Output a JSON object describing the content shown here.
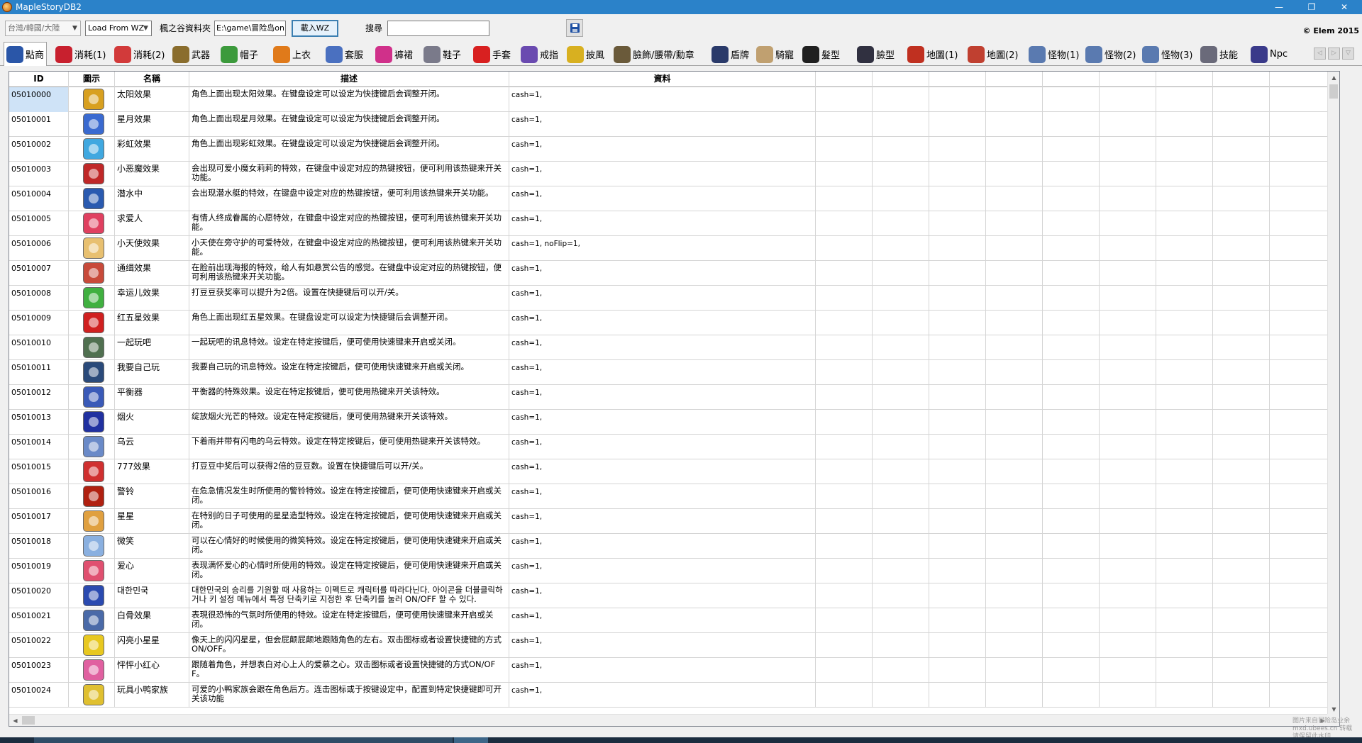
{
  "window": {
    "title": "MapleStoryDB2",
    "minimize": "—",
    "maximize": "❐",
    "close": "✕"
  },
  "toolbar": {
    "region_select": "台灣/韓國/大陸",
    "source_select": "Load From WZ",
    "folder_label": "楓之谷資料夾",
    "folder_path": "E:\\game\\冒险岛onl",
    "load_button": "載入WZ",
    "search_label": "搜尋",
    "search_value": "",
    "copyright": "© Elem 2015"
  },
  "tabs": [
    {
      "label": "點商",
      "icon": "cash-shop-icon",
      "color": "#2a56a8",
      "active": true
    },
    {
      "label": "消耗(1)",
      "icon": "potion-icon",
      "color": "#c8202e"
    },
    {
      "label": "消耗(2)",
      "icon": "potion-icon",
      "color": "#d23a3a"
    },
    {
      "label": "武器",
      "icon": "sword-icon",
      "color": "#8a6d2d"
    },
    {
      "label": "帽子",
      "icon": "hat-icon",
      "color": "#3c9a3c"
    },
    {
      "label": "上衣",
      "icon": "shirt-icon",
      "color": "#e07a1a"
    },
    {
      "label": "套服",
      "icon": "overall-icon",
      "color": "#4a70c0"
    },
    {
      "label": "褲裙",
      "icon": "pants-icon",
      "color": "#d0308a"
    },
    {
      "label": "鞋子",
      "icon": "shoe-icon",
      "color": "#7a7a8a"
    },
    {
      "label": "手套",
      "icon": "glove-icon",
      "color": "#d82020"
    },
    {
      "label": "戒指",
      "icon": "ring-icon",
      "color": "#6a4ab0"
    },
    {
      "label": "披風",
      "icon": "cape-icon",
      "color": "#d8b020"
    },
    {
      "label": "臉飾/腰帶/勳章",
      "icon": "accessory-icon",
      "color": "#6a5a3a"
    },
    {
      "label": "盾牌",
      "icon": "shield-icon",
      "color": "#2a3a6a"
    },
    {
      "label": "騎寵",
      "icon": "mount-icon",
      "color": "#c0a070"
    },
    {
      "label": "髮型",
      "icon": "hair-icon",
      "color": "#202020"
    },
    {
      "label": "臉型",
      "icon": "face-icon",
      "color": "#303040"
    },
    {
      "label": "地圖(1)",
      "icon": "map-icon",
      "color": "#c03020"
    },
    {
      "label": "地圖(2)",
      "icon": "map-icon",
      "color": "#c04030"
    },
    {
      "label": "怪物(1)",
      "icon": "monster-icon",
      "color": "#5a7ab0"
    },
    {
      "label": "怪物(2)",
      "icon": "monster-icon",
      "color": "#5a7ab0"
    },
    {
      "label": "怪物(3)",
      "icon": "monster-icon",
      "color": "#5a7ab0"
    },
    {
      "label": "技能",
      "icon": "skill-icon",
      "color": "#6a6a7a"
    },
    {
      "label": "Npc",
      "icon": "npc-icon",
      "color": "#3a3a8a"
    }
  ],
  "table": {
    "columns": [
      "ID",
      "圖示",
      "名稱",
      "描述",
      "資料"
    ],
    "rows": [
      {
        "id": "05010000",
        "icon": "#d8a020",
        "name": "太阳效果",
        "desc": "角色上面出现太阳效果。在键盘设定可以设定为快捷键后会调整开闭。",
        "data": "cash=1,"
      },
      {
        "id": "05010001",
        "icon": "#3a6ad0",
        "name": "星月效果",
        "desc": "角色上面出现星月效果。在键盘设定可以设定为快捷键后会调整开闭。",
        "data": "cash=1,"
      },
      {
        "id": "05010002",
        "icon": "#40a8e0",
        "name": "彩虹效果",
        "desc": "角色上面出现彩虹效果。在键盘设定可以设定为快捷键后会调整开闭。",
        "data": "cash=1,"
      },
      {
        "id": "05010003",
        "icon": "#c02828",
        "name": "小恶魔效果",
        "desc": "会出现可爱小魔女莉莉的特效，在键盘中设定对应的热键按钮，便可利用该热键来开关功能。",
        "data": "cash=1,"
      },
      {
        "id": "05010004",
        "icon": "#2a5ab0",
        "name": "潜水中",
        "desc": "会出现潜水艇的特效，在键盘中设定对应的热键按钮，便可利用该热键来开关功能。",
        "data": "cash=1,"
      },
      {
        "id": "05010005",
        "icon": "#e04060",
        "name": "求爱人",
        "desc": "有情人终成眷属的心愿特效，在键盘中设定对应的热键按钮，便可利用该热键来开关功能。",
        "data": "cash=1,"
      },
      {
        "id": "05010006",
        "icon": "#e8c070",
        "name": "小天使效果",
        "desc": "小天使在旁守护的可爱特效，在键盘中设定对应的热键按钮，便可利用该热键来开关功能。",
        "data": "cash=1, noFlip=1,"
      },
      {
        "id": "05010007",
        "icon": "#c84a3a",
        "name": "通缉效果",
        "desc": "在脸前出现海报的特效，给人有如悬赏公告的感觉。在键盘中设定对应的热键按钮，便可利用该热键来开关功能。",
        "data": "cash=1,"
      },
      {
        "id": "05010008",
        "icon": "#40b040",
        "name": "幸运儿效果",
        "desc": "打豆豆获奖率可以提升为2倍。设置在快捷键后可以开/关。",
        "data": "cash=1,"
      },
      {
        "id": "05010009",
        "icon": "#d02020",
        "name": "红五星效果",
        "desc": "角色上面出现红五星效果。在键盘设定可以设定为快捷键后会调整开闭。",
        "data": "cash=1,"
      },
      {
        "id": "05010010",
        "icon": "#507050",
        "name": "一起玩吧",
        "desc": "一起玩吧的讯息特效。设定在特定按键后，便可使用快速键来开启或关闭。",
        "data": "cash=1,"
      },
      {
        "id": "05010011",
        "icon": "#2a4a7a",
        "name": "我要自己玩",
        "desc": "我要自己玩的讯息特效。设定在特定按键后，便可使用快速键来开启或关闭。",
        "data": "cash=1,"
      },
      {
        "id": "05010012",
        "icon": "#3a5ab8",
        "name": "平衡器",
        "desc": "平衡器的特殊效果。设定在特定按键后，便可使用热键来开关该特效。",
        "data": "cash=1,"
      },
      {
        "id": "05010013",
        "icon": "#2030a0",
        "name": "烟火",
        "desc": "绽放烟火光芒的特效。设定在特定按键后，便可使用热键来开关该特效。",
        "data": "cash=1,"
      },
      {
        "id": "05010014",
        "icon": "#6a8ac8",
        "name": "乌云",
        "desc": "下着雨并带有闪电的乌云特效。设定在特定按键后，便可使用热键来开关该特效。",
        "data": "cash=1,"
      },
      {
        "id": "05010015",
        "icon": "#d03030",
        "name": "777效果",
        "desc": "打豆豆中奖后可以获得2倍的豆豆数。设置在快捷键后可以开/关。",
        "data": "cash=1,"
      },
      {
        "id": "05010016",
        "icon": "#b02010",
        "name": "警铃",
        "desc": "在危急情况发生时所使用的警铃特效。设定在特定按键后，便可使用快速键来开启或关闭。",
        "data": "cash=1,"
      },
      {
        "id": "05010017",
        "icon": "#e0a040",
        "name": "星星",
        "desc": "在特别的日子可使用的星星造型特效。设定在特定按键后，便可使用快速键来开启或关闭。",
        "data": "cash=1,"
      },
      {
        "id": "05010018",
        "icon": "#8ab0e0",
        "name": "微笑",
        "desc": "可以在心情好的时候使用的微笑特效。设定在特定按键后，便可使用快速键来开启或关闭。",
        "data": "cash=1,"
      },
      {
        "id": "05010019",
        "icon": "#e05070",
        "name": "爱心",
        "desc": "表现满怀爱心的心情时所使用的特效。设定在特定按键后，便可使用快速键来开启或关闭。",
        "data": "cash=1,"
      },
      {
        "id": "05010020",
        "icon": "#2a4ab0",
        "name": "대한민국",
        "desc": "대한민국의 승리를 기원할 때 사용하는 이펙트로 캐릭터를 따라다닌다. 아이콘을 더블클릭하거나 키 설정 메뉴에서 특정 단축키로 지정한 후 단축키를 눌러 ON/OFF 할 수 있다.",
        "data": "cash=1,"
      },
      {
        "id": "05010021",
        "icon": "#4a6aa8",
        "name": "白骨效果",
        "desc": "表現很恐怖的气氛时所使用的特效。设定在特定按键后，便可使用快速键来开启或关闭。",
        "data": "cash=1,"
      },
      {
        "id": "05010022",
        "icon": "#e8c820",
        "name": "闪亮小星星",
        "desc": "像天上的闪闪星星，但会屁颠屁颠地跟随角色的左右。双击图标或者设置快捷键的方式ON/OFF。",
        "data": "cash=1,"
      },
      {
        "id": "05010023",
        "icon": "#e060a0",
        "name": "怦怦小红心",
        "desc": "跟随着角色，并想表白对心上人的爱慕之心。双击图标或者设置快捷键的方式ON/OFF。",
        "data": "cash=1,"
      },
      {
        "id": "05010024",
        "icon": "#e0c030",
        "name": "玩具小鸭家族",
        "desc": "可爱的小鸭家族会跟在角色后方。连击图标或于按键设定中，配置到特定快捷键即可开关该功能",
        "data": "cash=1,"
      }
    ]
  },
  "scrollbars": {
    "up": "▲",
    "down": "▼",
    "left": "◀",
    "right": "▶"
  },
  "tabnav": {
    "prev": "◁",
    "next": "▷",
    "list": "▽"
  },
  "watermark": "图片来自冒险岛业余 mxd.ubees.cn 转载请保留此水印"
}
